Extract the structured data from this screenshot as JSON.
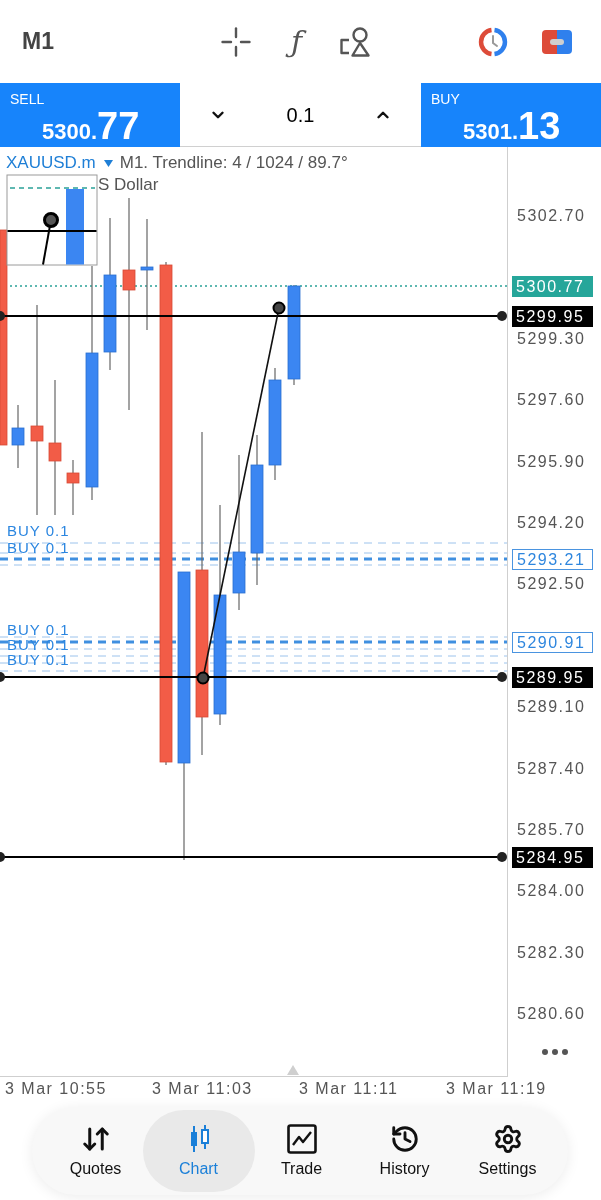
{
  "top_bar": {
    "timeframe": "M1",
    "indicator_glyph": "ƒ"
  },
  "trade_panel": {
    "sell": {
      "label": "SELL",
      "price_head": "5300.",
      "price_tail": "77"
    },
    "volume": "0.1",
    "buy": {
      "label": "BUY",
      "price_head": "5301.",
      "price_tail": "13"
    }
  },
  "chart": {
    "symbol": "XAUUSD.m",
    "info": "M1. Trendline: 4 / 1024 / 89.7°",
    "description": "S Dollar",
    "order_labels": [
      "BUY 0.1",
      "BUY 0.1",
      "BUY 0.1",
      "BUY 0.1",
      "BUY 0.1"
    ],
    "price_ticks": [
      "5302.70",
      "5299.30",
      "5297.60",
      "5295.90",
      "5294.20",
      "5292.50",
      "5289.10",
      "5287.40",
      "5285.70",
      "5284.00",
      "5282.30",
      "5280.60"
    ],
    "price_markers": [
      {
        "kind": "bid",
        "text": "5300.77"
      },
      {
        "kind": "line",
        "text": "5299.95"
      },
      {
        "kind": "order",
        "text": "5293.21"
      },
      {
        "kind": "order",
        "text": "5290.91"
      },
      {
        "kind": "line",
        "text": "5289.95"
      },
      {
        "kind": "line",
        "text": "5284.95"
      }
    ],
    "time_labels": [
      "3 Mar 10:55",
      "3 Mar 11:03",
      "3 Mar 11:11",
      "3 Mar 11:19"
    ]
  },
  "nav": [
    {
      "label": "Quotes",
      "selected": false
    },
    {
      "label": "Chart",
      "selected": true
    },
    {
      "label": "Trade",
      "selected": false
    },
    {
      "label": "History",
      "selected": false
    },
    {
      "label": "Settings",
      "selected": false
    }
  ]
}
